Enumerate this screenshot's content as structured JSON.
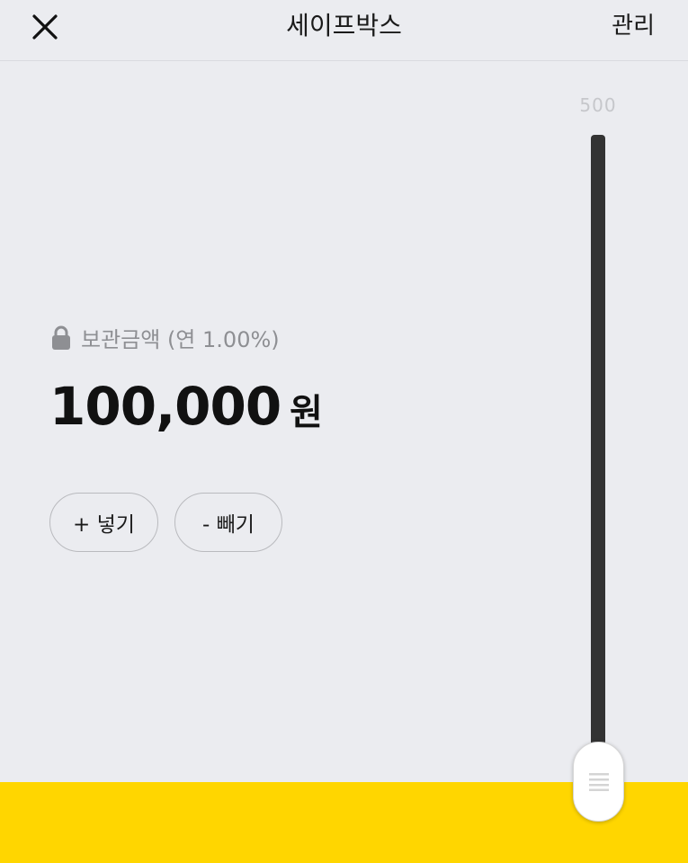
{
  "header": {
    "title": "세이프박스",
    "manage_label": "관리",
    "close_icon": "close-icon"
  },
  "slider": {
    "max_label": "500",
    "level_fraction": 0.0
  },
  "balance": {
    "label": "보관금액 (연 1.00%)",
    "lock_icon": "lock-icon",
    "amount": "100,000",
    "unit": "원"
  },
  "actions": {
    "deposit_label": "+ 넣기",
    "withdraw_label": "- 빼기"
  },
  "colors": {
    "background": "#ebecf0",
    "accent": "#ffd600",
    "track": "#333333",
    "muted_text": "#8e8f93"
  }
}
